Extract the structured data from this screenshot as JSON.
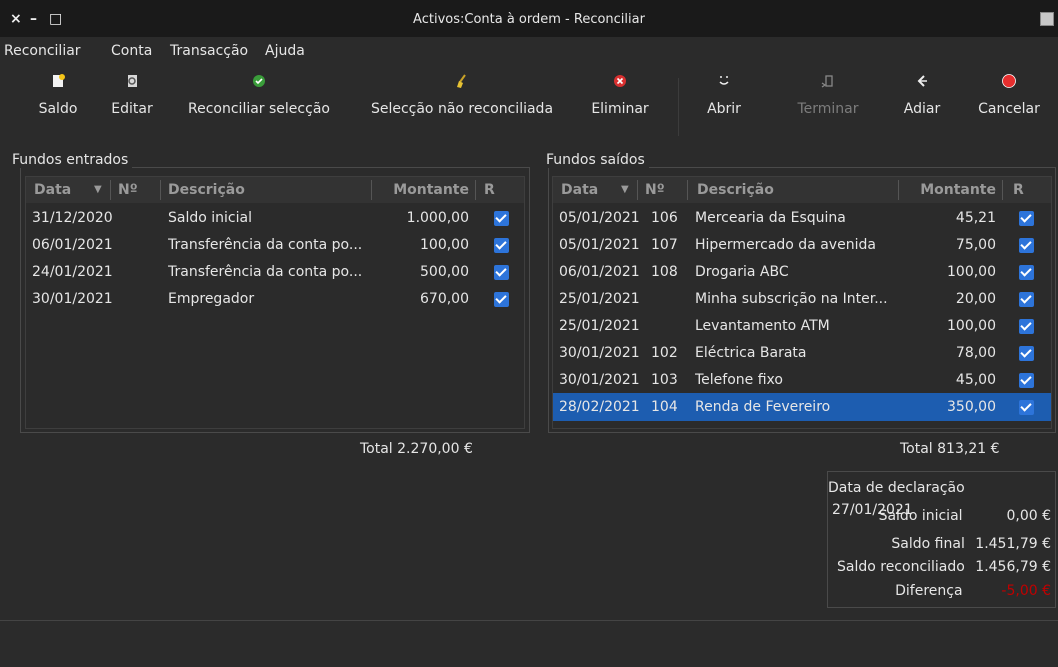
{
  "window": {
    "title": "Activos:Conta à ordem - Reconciliar",
    "controls": {
      "close": "×",
      "minimize": "–",
      "maximize": "□"
    }
  },
  "menu": [
    "Reconciliar",
    "Conta",
    "Transacção",
    "Ajuda"
  ],
  "toolbar": [
    {
      "label": "Saldo",
      "icon": "balance-icon",
      "disabled": false
    },
    {
      "label": "Editar",
      "icon": "edit-icon",
      "disabled": false
    },
    {
      "label": "Reconciliar selecção",
      "icon": "check-circle-icon",
      "disabled": false
    },
    {
      "label": "Selecção não reconciliada",
      "icon": "broom-icon",
      "disabled": false
    },
    {
      "label": "Eliminar",
      "icon": "delete-icon",
      "disabled": false
    },
    {
      "label": "Abrir",
      "icon": "open-icon",
      "disabled": false
    },
    {
      "label": "Terminar",
      "icon": "finish-icon",
      "disabled": true
    },
    {
      "label": "Adiar",
      "icon": "back-arrow-icon",
      "disabled": false
    },
    {
      "label": "Cancelar",
      "icon": "cancel-icon",
      "disabled": false
    }
  ],
  "funds_in": {
    "label": "Fundos entrados",
    "columns": {
      "date": "Data",
      "num": "Nº",
      "desc": "Descrição",
      "amount": "Montante",
      "r": "R"
    },
    "rows": [
      {
        "date": "31/12/2020",
        "num": "",
        "desc": "Saldo inicial",
        "amount": "1.000,00",
        "r": true
      },
      {
        "date": "06/01/2021",
        "num": "",
        "desc": "Transferência da conta po...",
        "amount": "100,00",
        "r": true
      },
      {
        "date": "24/01/2021",
        "num": "",
        "desc": "Transferência da conta po...",
        "amount": "500,00",
        "r": true
      },
      {
        "date": "30/01/2021",
        "num": "",
        "desc": "Empregador",
        "amount": "670,00",
        "r": true
      }
    ],
    "total": "Total 2.270,00 €"
  },
  "funds_out": {
    "label": "Fundos saídos",
    "columns": {
      "date": "Data",
      "num": "Nº",
      "desc": "Descrição",
      "amount": "Montante",
      "r": "R"
    },
    "rows": [
      {
        "date": "05/01/2021",
        "num": "106",
        "desc": "Mercearia da Esquina",
        "amount": "45,21",
        "r": true,
        "selected": false
      },
      {
        "date": "05/01/2021",
        "num": "107",
        "desc": "Hipermercado da avenida",
        "amount": "75,00",
        "r": true,
        "selected": false
      },
      {
        "date": "06/01/2021",
        "num": "108",
        "desc": "Drogaria ABC",
        "amount": "100,00",
        "r": true,
        "selected": false
      },
      {
        "date": "25/01/2021",
        "num": "",
        "desc": "Minha subscrição na Inter...",
        "amount": "20,00",
        "r": true,
        "selected": false
      },
      {
        "date": "25/01/2021",
        "num": "",
        "desc": "Levantamento ATM",
        "amount": "100,00",
        "r": true,
        "selected": false
      },
      {
        "date": "30/01/2021",
        "num": "102",
        "desc": "Eléctrica Barata",
        "amount": "78,00",
        "r": true,
        "selected": false
      },
      {
        "date": "30/01/2021",
        "num": "103",
        "desc": "Telefone fixo",
        "amount": "45,00",
        "r": true,
        "selected": false
      },
      {
        "date": "28/02/2021",
        "num": "104",
        "desc": "Renda de Fevereiro",
        "amount": "350,00",
        "r": true,
        "selected": true
      }
    ],
    "total": "Total 813,21 €"
  },
  "summary": {
    "statement_date_label": "Data de declaração",
    "statement_date": "27/01/2021",
    "start_label": "Saldo inicial",
    "start": "0,00 €",
    "end_label": "Saldo final",
    "end": "1.451,79 €",
    "reconciled_label": "Saldo reconciliado",
    "reconciled": "1.456,79 €",
    "diff_label": "Diferença",
    "diff": "-5,00 €"
  },
  "colors": {
    "selection": "#1d5db0",
    "checkbox": "#2d74da",
    "negative": "#c00000"
  }
}
